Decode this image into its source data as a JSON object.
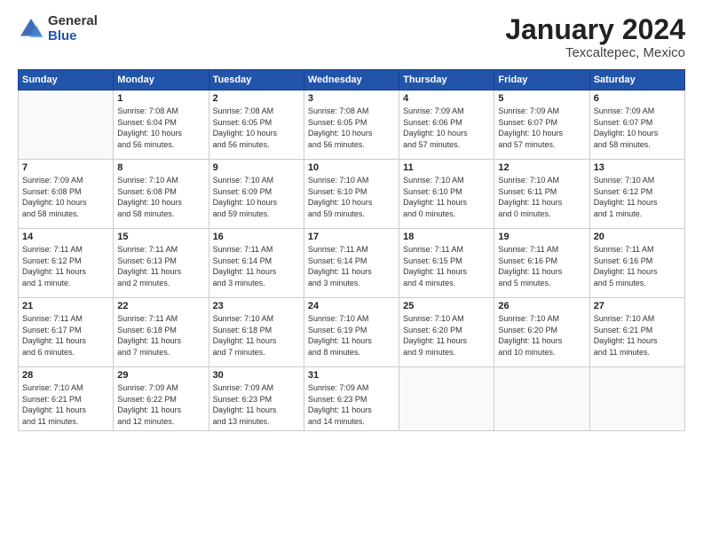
{
  "header": {
    "logo_general": "General",
    "logo_blue": "Blue",
    "title": "January 2024",
    "subtitle": "Texcaltepec, Mexico"
  },
  "columns": [
    "Sunday",
    "Monday",
    "Tuesday",
    "Wednesday",
    "Thursday",
    "Friday",
    "Saturday"
  ],
  "weeks": [
    [
      {
        "num": "",
        "info": ""
      },
      {
        "num": "1",
        "info": "Sunrise: 7:08 AM\nSunset: 6:04 PM\nDaylight: 10 hours\nand 56 minutes."
      },
      {
        "num": "2",
        "info": "Sunrise: 7:08 AM\nSunset: 6:05 PM\nDaylight: 10 hours\nand 56 minutes."
      },
      {
        "num": "3",
        "info": "Sunrise: 7:08 AM\nSunset: 6:05 PM\nDaylight: 10 hours\nand 56 minutes."
      },
      {
        "num": "4",
        "info": "Sunrise: 7:09 AM\nSunset: 6:06 PM\nDaylight: 10 hours\nand 57 minutes."
      },
      {
        "num": "5",
        "info": "Sunrise: 7:09 AM\nSunset: 6:07 PM\nDaylight: 10 hours\nand 57 minutes."
      },
      {
        "num": "6",
        "info": "Sunrise: 7:09 AM\nSunset: 6:07 PM\nDaylight: 10 hours\nand 58 minutes."
      }
    ],
    [
      {
        "num": "7",
        "info": "Sunrise: 7:09 AM\nSunset: 6:08 PM\nDaylight: 10 hours\nand 58 minutes."
      },
      {
        "num": "8",
        "info": "Sunrise: 7:10 AM\nSunset: 6:08 PM\nDaylight: 10 hours\nand 58 minutes."
      },
      {
        "num": "9",
        "info": "Sunrise: 7:10 AM\nSunset: 6:09 PM\nDaylight: 10 hours\nand 59 minutes."
      },
      {
        "num": "10",
        "info": "Sunrise: 7:10 AM\nSunset: 6:10 PM\nDaylight: 10 hours\nand 59 minutes."
      },
      {
        "num": "11",
        "info": "Sunrise: 7:10 AM\nSunset: 6:10 PM\nDaylight: 11 hours\nand 0 minutes."
      },
      {
        "num": "12",
        "info": "Sunrise: 7:10 AM\nSunset: 6:11 PM\nDaylight: 11 hours\nand 0 minutes."
      },
      {
        "num": "13",
        "info": "Sunrise: 7:10 AM\nSunset: 6:12 PM\nDaylight: 11 hours\nand 1 minute."
      }
    ],
    [
      {
        "num": "14",
        "info": "Sunrise: 7:11 AM\nSunset: 6:12 PM\nDaylight: 11 hours\nand 1 minute."
      },
      {
        "num": "15",
        "info": "Sunrise: 7:11 AM\nSunset: 6:13 PM\nDaylight: 11 hours\nand 2 minutes."
      },
      {
        "num": "16",
        "info": "Sunrise: 7:11 AM\nSunset: 6:14 PM\nDaylight: 11 hours\nand 3 minutes."
      },
      {
        "num": "17",
        "info": "Sunrise: 7:11 AM\nSunset: 6:14 PM\nDaylight: 11 hours\nand 3 minutes."
      },
      {
        "num": "18",
        "info": "Sunrise: 7:11 AM\nSunset: 6:15 PM\nDaylight: 11 hours\nand 4 minutes."
      },
      {
        "num": "19",
        "info": "Sunrise: 7:11 AM\nSunset: 6:16 PM\nDaylight: 11 hours\nand 5 minutes."
      },
      {
        "num": "20",
        "info": "Sunrise: 7:11 AM\nSunset: 6:16 PM\nDaylight: 11 hours\nand 5 minutes."
      }
    ],
    [
      {
        "num": "21",
        "info": "Sunrise: 7:11 AM\nSunset: 6:17 PM\nDaylight: 11 hours\nand 6 minutes."
      },
      {
        "num": "22",
        "info": "Sunrise: 7:11 AM\nSunset: 6:18 PM\nDaylight: 11 hours\nand 7 minutes."
      },
      {
        "num": "23",
        "info": "Sunrise: 7:10 AM\nSunset: 6:18 PM\nDaylight: 11 hours\nand 7 minutes."
      },
      {
        "num": "24",
        "info": "Sunrise: 7:10 AM\nSunset: 6:19 PM\nDaylight: 11 hours\nand 8 minutes."
      },
      {
        "num": "25",
        "info": "Sunrise: 7:10 AM\nSunset: 6:20 PM\nDaylight: 11 hours\nand 9 minutes."
      },
      {
        "num": "26",
        "info": "Sunrise: 7:10 AM\nSunset: 6:20 PM\nDaylight: 11 hours\nand 10 minutes."
      },
      {
        "num": "27",
        "info": "Sunrise: 7:10 AM\nSunset: 6:21 PM\nDaylight: 11 hours\nand 11 minutes."
      }
    ],
    [
      {
        "num": "28",
        "info": "Sunrise: 7:10 AM\nSunset: 6:21 PM\nDaylight: 11 hours\nand 11 minutes."
      },
      {
        "num": "29",
        "info": "Sunrise: 7:09 AM\nSunset: 6:22 PM\nDaylight: 11 hours\nand 12 minutes."
      },
      {
        "num": "30",
        "info": "Sunrise: 7:09 AM\nSunset: 6:23 PM\nDaylight: 11 hours\nand 13 minutes."
      },
      {
        "num": "31",
        "info": "Sunrise: 7:09 AM\nSunset: 6:23 PM\nDaylight: 11 hours\nand 14 minutes."
      },
      {
        "num": "",
        "info": ""
      },
      {
        "num": "",
        "info": ""
      },
      {
        "num": "",
        "info": ""
      }
    ]
  ]
}
